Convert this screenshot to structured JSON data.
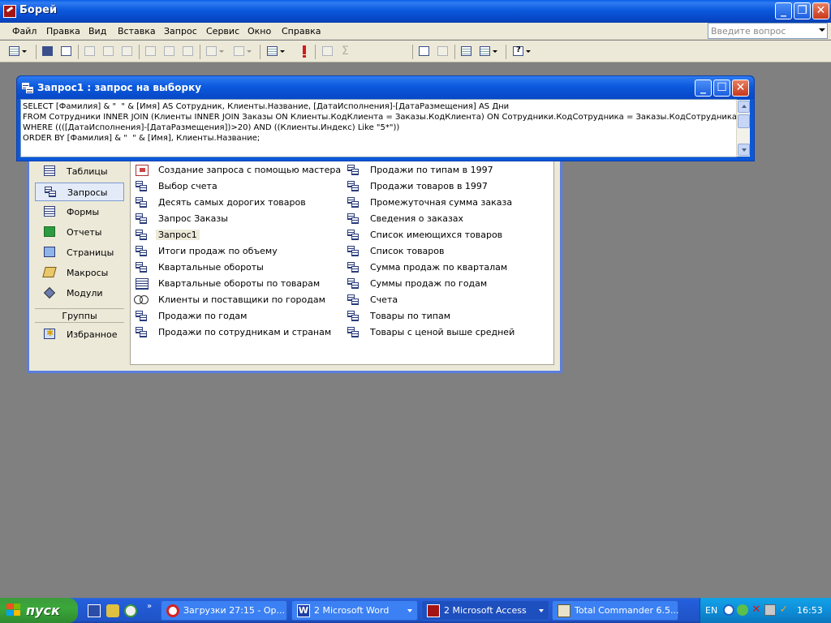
{
  "window": {
    "title": "Борей"
  },
  "menu": [
    "Файл",
    "Правка",
    "Вид",
    "Вставка",
    "Запрос",
    "Сервис",
    "Окно",
    "Справка"
  ],
  "help": {
    "placeholder": "Введите вопрос"
  },
  "query_window": {
    "title": "Запрос1 : запрос на выборку",
    "sql": [
      "SELECT [Фамилия] & \"  \" & [Имя] AS Сотрудник, Клиенты.Название, [ДатаИсполнения]-[ДатаРазмещения] AS Дни",
      "FROM Сотрудники INNER JOIN (Клиенты INNER JOIN Заказы ON Клиенты.КодКлиента = Заказы.КодКлиента) ON Сотрудники.КодСотрудника = Заказы.КодСотрудника",
      "WHERE ((([ДатаИсполнения]-[ДатаРазмещения])>20) AND ((Клиенты.Индекс) Like \"5*\"))",
      "ORDER BY [Фамилия] & \"  \" & [Имя], Клиенты.Название;"
    ]
  },
  "nav": {
    "items": [
      "Таблицы",
      "Запросы",
      "Формы",
      "Отчеты",
      "Страницы",
      "Макросы",
      "Модули"
    ],
    "active_index": 1,
    "groups_label": "Группы",
    "favorites": "Избранное"
  },
  "objects": {
    "left": [
      "Создание запроса с помощью мастера",
      "Выбор счета",
      "Десять самых дорогих товаров",
      "Запрос Заказы",
      "Запрос1",
      "Итоги продаж по объему",
      "Квартальные обороты",
      "Квартальные обороты по товарам",
      "Клиенты и поставщики по городам",
      "Продажи по годам",
      "Продажи по сотрудникам и странам"
    ],
    "right": [
      "Продажи по типам в 1997",
      "Продажи товаров в 1997",
      "Промежуточная сумма заказа",
      "Сведения о заказах",
      "Список имеющихся товаров",
      "Список товаров",
      "Сумма продаж по кварталам",
      "Суммы продаж по годам",
      "Счета",
      "Товары по типам",
      "Товары с ценой выше средней"
    ],
    "selected": "Запрос1"
  },
  "taskbar": {
    "start_label": "пуск",
    "tasks": [
      {
        "label": "Загрузки 27:15 - Op...",
        "active": false
      },
      {
        "label": "2 Microsoft Word",
        "active": false
      },
      {
        "label": "2 Microsoft Access",
        "active": true
      },
      {
        "label": "Total Commander 6.5...",
        "active": false
      }
    ],
    "lang": "EN",
    "clock": "16:53"
  }
}
